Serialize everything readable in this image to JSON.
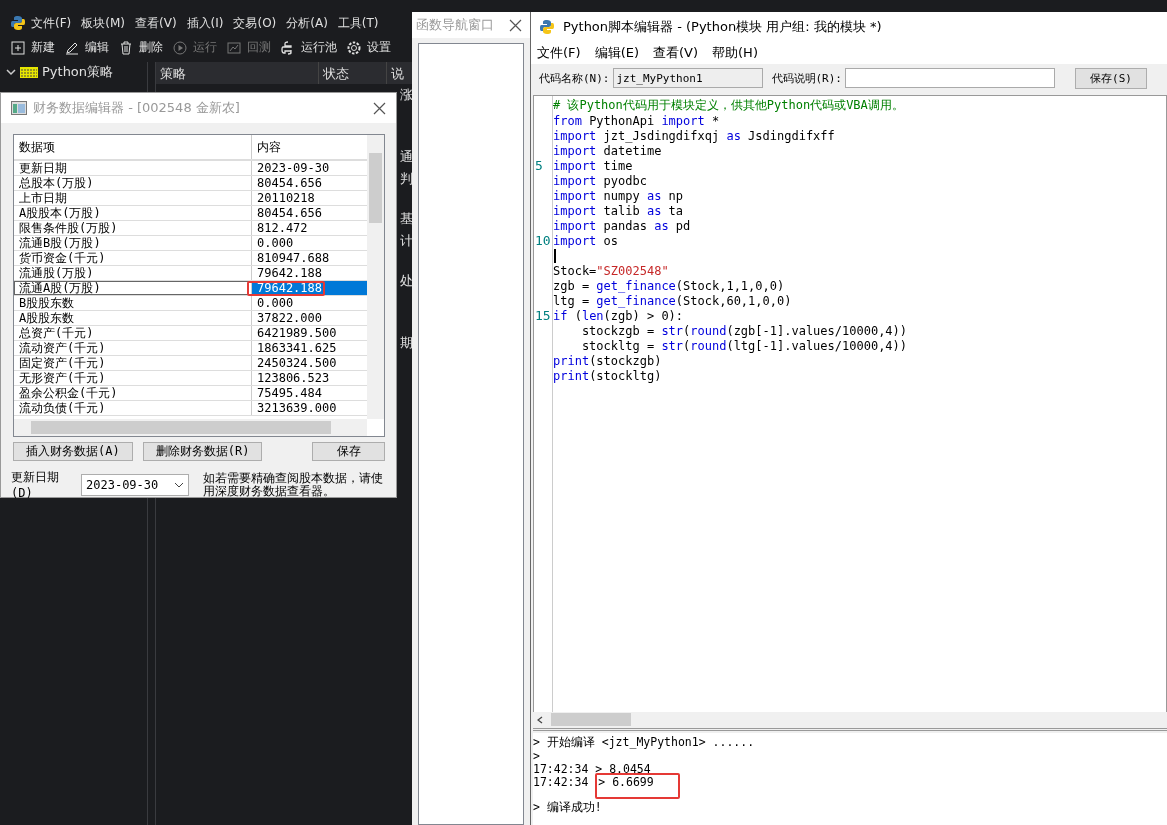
{
  "app": {
    "menu": [
      "文件(F)",
      "板块(M)",
      "查看(V)",
      "插入(I)",
      "交易(O)",
      "分析(A)",
      "工具(T)"
    ],
    "toolbar": [
      {
        "label": "新建",
        "disabled": false
      },
      {
        "label": "编辑",
        "disabled": false
      },
      {
        "label": "删除",
        "disabled": false
      },
      {
        "label": "运行",
        "disabled": true
      },
      {
        "label": "回测",
        "disabled": true
      },
      {
        "label": "运行池",
        "disabled": false
      },
      {
        "label": "设置",
        "disabled": false
      }
    ],
    "tree": [
      {
        "label": "Python策略",
        "expanded": true
      }
    ],
    "table": {
      "columns": [
        "策略",
        "状态",
        "说"
      ],
      "column_3_cells": [
        [
          "涨"
        ],
        [
          "通",
          "判"
        ],
        [
          "基",
          "计"
        ],
        [
          "处"
        ],
        [
          "期"
        ]
      ]
    }
  },
  "finance": {
    "title": "财务数据编辑器 - [002548 金新农]",
    "columns": [
      "数据项",
      "内容"
    ],
    "rows": [
      {
        "item": "更新日期",
        "value": "2023-09-30",
        "selected": false,
        "boxed": false
      },
      {
        "item": "总股本(万股)",
        "value": "80454.656",
        "selected": false,
        "boxed": false
      },
      {
        "item": "上市日期",
        "value": "20110218",
        "selected": false,
        "boxed": false
      },
      {
        "item": "A股股本(万股)",
        "value": "80454.656",
        "selected": false,
        "boxed": false
      },
      {
        "item": "限售条件股(万股)",
        "value": "812.472",
        "selected": false,
        "boxed": false
      },
      {
        "item": "流通B股(万股)",
        "value": "0.000",
        "selected": false,
        "boxed": false
      },
      {
        "item": "货币资金(千元)",
        "value": "810947.688",
        "selected": false,
        "boxed": false
      },
      {
        "item": "流通股(万股)",
        "value": "79642.188",
        "selected": false,
        "boxed": false
      },
      {
        "item": "流通A股(万股)",
        "value": "79642.188",
        "selected": true,
        "boxed": true
      },
      {
        "item": "B股股东数",
        "value": "0.000",
        "selected": false,
        "boxed": false
      },
      {
        "item": "A股股东数",
        "value": "37822.000",
        "selected": false,
        "boxed": false
      },
      {
        "item": "总资产(千元)",
        "value": "6421989.500",
        "selected": false,
        "boxed": false
      },
      {
        "item": "流动资产(千元)",
        "value": "1863341.625",
        "selected": false,
        "boxed": false
      },
      {
        "item": "固定资产(千元)",
        "value": "2450324.500",
        "selected": false,
        "boxed": false
      },
      {
        "item": "无形资产(千元)",
        "value": "123806.523",
        "selected": false,
        "boxed": false
      },
      {
        "item": "盈余公积金(千元)",
        "value": "75495.484",
        "selected": false,
        "boxed": false
      },
      {
        "item": "流动负债(千元)",
        "value": "3213639.000",
        "selected": false,
        "boxed": false
      }
    ],
    "buttons": [
      "插入财务数据(A)",
      "删除财务数据(R)",
      "保存"
    ],
    "date_label": "更新日期(D)",
    "date_value": "2023-09-30",
    "note": "如若需要精确查阅股本数据，请使用深度财务数据查看器。"
  },
  "navigator": {
    "title": "函数导航窗口"
  },
  "editor": {
    "title": "Python脚本编辑器 - (Python模块 用户组: 我的模块 *)",
    "menu": [
      "文件(F)",
      "编辑(E)",
      "查看(V)",
      "帮助(H)"
    ],
    "name_label": "代码名称(N):",
    "name_value": "jzt_MyPython1",
    "desc_label": "代码说明(R):",
    "save": "保存(S)",
    "lines": [
      {
        "kind": "code",
        "tokens": [
          {
            "kind": "comment",
            "text": "# 该Python代码用于模块定义，供其他Python代码或VBA调用。"
          }
        ]
      },
      {
        "kind": "code",
        "tokens": [
          {
            "kind": "keyword",
            "text": "from"
          },
          {
            "kind": "plain",
            "text": " PythonApi "
          },
          {
            "kind": "keyword",
            "text": "import"
          },
          {
            "kind": "plain",
            "text": " *"
          }
        ]
      },
      {
        "kind": "code",
        "tokens": [
          {
            "kind": "keyword",
            "text": "import"
          },
          {
            "kind": "plain",
            "text": " jzt_Jsdingdifxqj "
          },
          {
            "kind": "keyword",
            "text": "as"
          },
          {
            "kind": "plain",
            "text": " Jsdingdifxff"
          }
        ]
      },
      {
        "kind": "code",
        "tokens": [
          {
            "kind": "keyword",
            "text": "import"
          },
          {
            "kind": "plain",
            "text": " datetime"
          }
        ]
      },
      {
        "kind": "code",
        "number": "5",
        "tokens": [
          {
            "kind": "keyword",
            "text": "import"
          },
          {
            "kind": "plain",
            "text": " time"
          }
        ]
      },
      {
        "kind": "code",
        "tokens": [
          {
            "kind": "keyword",
            "text": "import"
          },
          {
            "kind": "plain",
            "text": " pyodbc"
          }
        ]
      },
      {
        "kind": "code",
        "tokens": [
          {
            "kind": "keyword",
            "text": "import"
          },
          {
            "kind": "plain",
            "text": " numpy "
          },
          {
            "kind": "keyword",
            "text": "as"
          },
          {
            "kind": "plain",
            "text": " np"
          }
        ]
      },
      {
        "kind": "code",
        "tokens": [
          {
            "kind": "keyword",
            "text": "import"
          },
          {
            "kind": "plain",
            "text": " talib "
          },
          {
            "kind": "keyword",
            "text": "as"
          },
          {
            "kind": "plain",
            "text": " ta"
          }
        ]
      },
      {
        "kind": "code",
        "tokens": [
          {
            "kind": "keyword",
            "text": "import"
          },
          {
            "kind": "plain",
            "text": " pandas "
          },
          {
            "kind": "keyword",
            "text": "as"
          },
          {
            "kind": "plain",
            "text": " pd"
          }
        ]
      },
      {
        "kind": "code",
        "number": "10",
        "tokens": [
          {
            "kind": "keyword",
            "text": "import"
          },
          {
            "kind": "plain",
            "text": " os"
          }
        ]
      },
      {
        "kind": "caret"
      },
      {
        "kind": "code",
        "tokens": [
          {
            "kind": "plain",
            "text": "Stock="
          },
          {
            "kind": "string",
            "text": "\"SZ002548\""
          }
        ]
      },
      {
        "kind": "code",
        "tokens": [
          {
            "kind": "plain",
            "text": "zgb = "
          },
          {
            "kind": "builtin",
            "text": "get_finance"
          },
          {
            "kind": "plain",
            "text": "(Stock,1,1,0,0)"
          }
        ]
      },
      {
        "kind": "code",
        "tokens": [
          {
            "kind": "plain",
            "text": "ltg = "
          },
          {
            "kind": "builtin",
            "text": "get_finance"
          },
          {
            "kind": "plain",
            "text": "(Stock,60,1,0,0)"
          }
        ]
      },
      {
        "kind": "code",
        "number": "15",
        "tokens": [
          {
            "kind": "keyword",
            "text": "if"
          },
          {
            "kind": "plain",
            "text": " ("
          },
          {
            "kind": "builtin",
            "text": "len"
          },
          {
            "kind": "plain",
            "text": "(zgb) > 0):"
          }
        ]
      },
      {
        "kind": "code",
        "tokens": [
          {
            "kind": "plain",
            "text": "    stockzgb = "
          },
          {
            "kind": "builtin",
            "text": "str"
          },
          {
            "kind": "plain",
            "text": "("
          },
          {
            "kind": "builtin",
            "text": "round"
          },
          {
            "kind": "plain",
            "text": "(zgb[-1].values/10000,4))"
          }
        ]
      },
      {
        "kind": "code",
        "tokens": [
          {
            "kind": "plain",
            "text": "    stockltg = "
          },
          {
            "kind": "builtin",
            "text": "str"
          },
          {
            "kind": "plain",
            "text": "("
          },
          {
            "kind": "builtin",
            "text": "round"
          },
          {
            "kind": "plain",
            "text": "(ltg[-1].values/10000,4))"
          }
        ]
      },
      {
        "kind": "code",
        "tokens": [
          {
            "kind": "builtin",
            "text": "print"
          },
          {
            "kind": "plain",
            "text": "(stockzgb)"
          }
        ]
      },
      {
        "kind": "code",
        "tokens": [
          {
            "kind": "builtin",
            "text": "print"
          },
          {
            "kind": "plain",
            "text": "(stockltg)"
          }
        ]
      }
    ],
    "console": [
      {
        "text": "> 开始编译 <jzt_MyPython1> ......",
        "boxed": false
      },
      {
        "text": ">",
        "boxed": false
      },
      {
        "time": "17:42:34",
        "text": "> 8.0454",
        "boxed": false
      },
      {
        "time": "17:42:34",
        "text": "> 6.6699",
        "boxed": true
      },
      {
        "text": "> 编译成功!",
        "boxed": false
      }
    ]
  }
}
